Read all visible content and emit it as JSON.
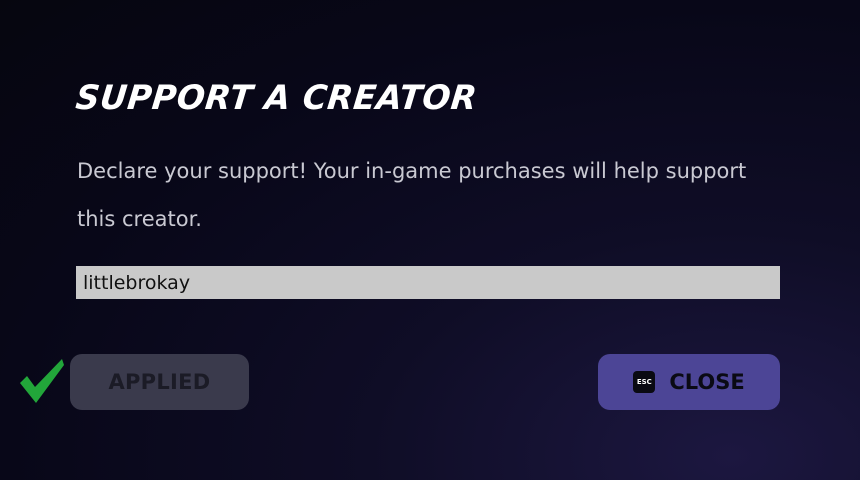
{
  "dialog": {
    "title": "SUPPORT A CREATOR",
    "description": "Declare your support! Your in-game purchases will help support this creator.",
    "creator_input_value": "littlebrokay",
    "applied_label": "APPLIED",
    "close_label": "CLOSE",
    "esc_key_label": "ESC",
    "check_icon": "check-icon",
    "colors": {
      "check": "#22a63a",
      "close_button": "#4c4596",
      "applied_button": "#3a3a4c"
    }
  }
}
